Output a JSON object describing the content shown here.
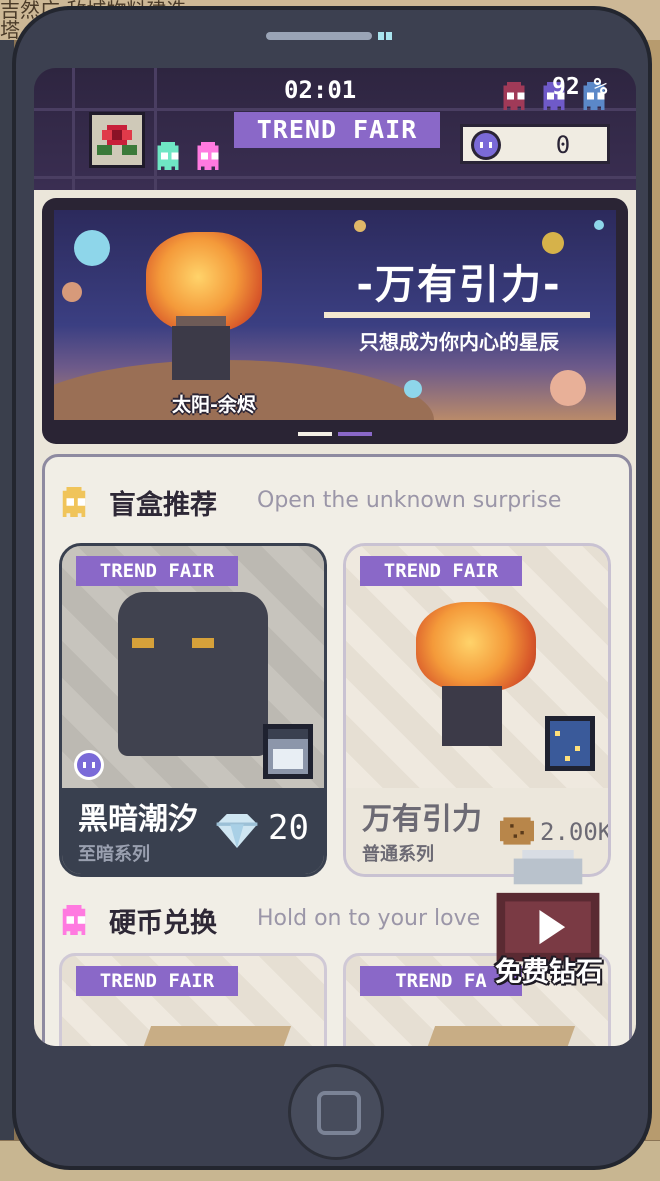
{
  "background": {
    "top_text": "吉然广 敌城物料建造\n塔"
  },
  "status": {
    "time": "02:01",
    "battery": "92 %"
  },
  "header": {
    "brand": "TREND FAIR",
    "coin_value": "0"
  },
  "banner": {
    "title": "-万有引力-",
    "subtitle": "只想成为你内心的星辰",
    "caption": "太阳-余烬",
    "pagination": [
      "page-1",
      "page-2"
    ]
  },
  "blind_box": {
    "title": "盲盒推荐",
    "subtitle": "Open the unknown surprise",
    "cards": [
      {
        "tag": "TREND FAIR",
        "name": "黑暗潮汐",
        "series": "至暗系列",
        "price": "20",
        "price_icon": "diamond-icon"
      },
      {
        "tag": "TREND FAIR",
        "name": "万有引力",
        "series": "普通系列",
        "price": "2.00K",
        "price_icon": "cookie-icon"
      }
    ]
  },
  "coin_exchange": {
    "title": "硬币兑换",
    "subtitle": "Hold on to your love",
    "cards": [
      {
        "tag": "TREND FAIR"
      },
      {
        "tag": "TREND FA"
      }
    ]
  },
  "free_diamond": {
    "label": "免费钻石"
  },
  "colors": {
    "accent_purple": "#8a68c8",
    "ghost_yellow": "#f0c45a",
    "ghost_pink": "#ff7ae0",
    "ghost_teal": "#6fe6c4"
  }
}
